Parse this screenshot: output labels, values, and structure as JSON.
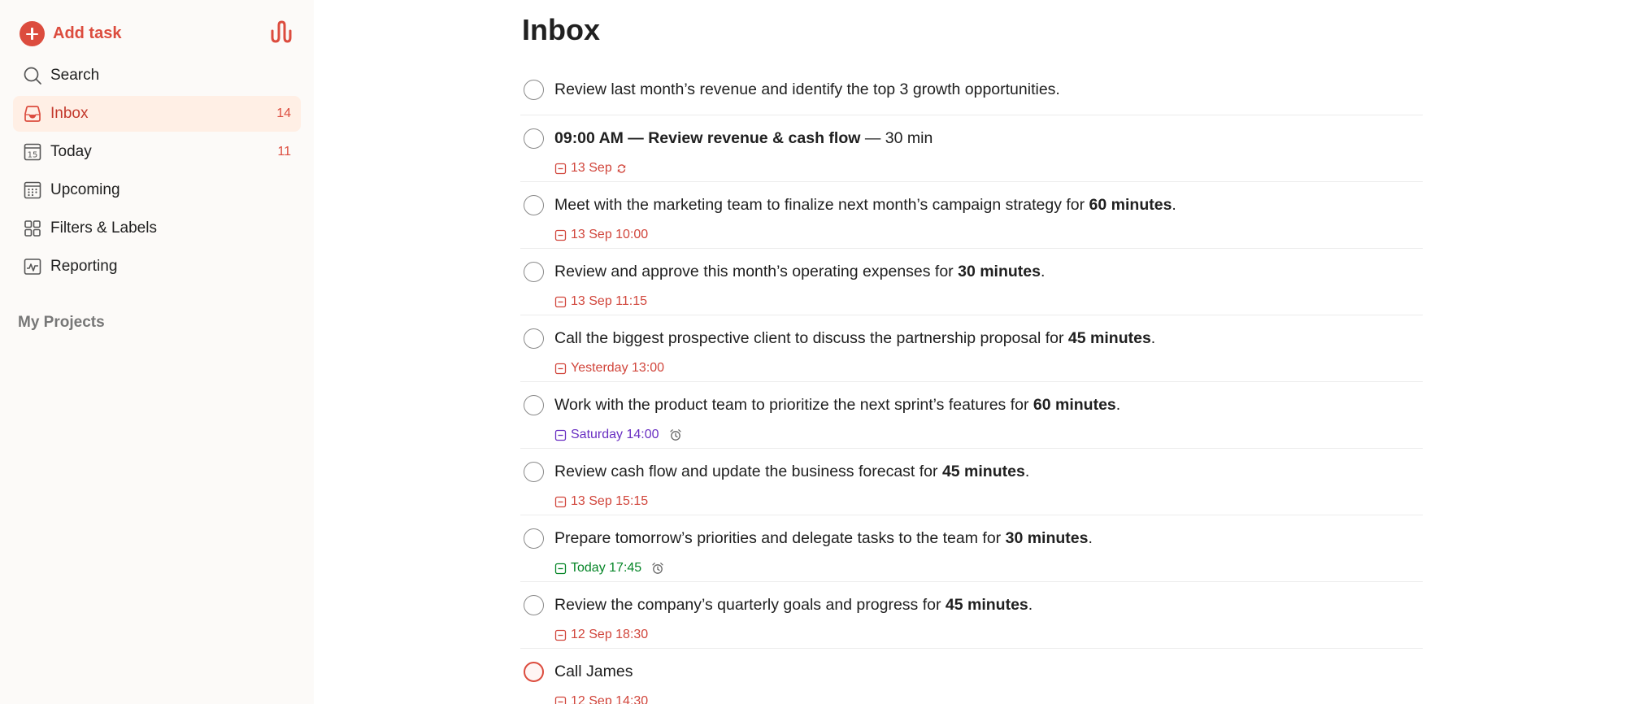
{
  "sidebar": {
    "add_task_label": "Add task",
    "brand_icon": "waveform-logo-icon",
    "nav": [
      {
        "label": "Search",
        "icon": "search-icon",
        "count": ""
      },
      {
        "label": "Inbox",
        "icon": "inbox-icon",
        "count": "14"
      },
      {
        "label": "Today",
        "icon": "calendar-today-icon",
        "count": "11",
        "day": "15"
      },
      {
        "label": "Upcoming",
        "icon": "calendar-grid-icon",
        "count": ""
      },
      {
        "label": "Filters & Labels",
        "icon": "grid-icon",
        "count": ""
      },
      {
        "label": "Reporting",
        "icon": "chart-icon",
        "count": ""
      }
    ],
    "projects_title": "My Projects"
  },
  "main": {
    "title": "Inbox",
    "tasks": [
      {
        "pre": "Review last month’s revenue and identify the top 3 growth opportunities.",
        "bold": "",
        "post": "",
        "date": "",
        "date_color": "",
        "repeat": false,
        "alarm": false
      },
      {
        "pre": "",
        "bold": "09:00 AM — Review revenue & cash flow",
        "post": " — 30 min",
        "date": "13 Sep",
        "date_color": "#d1453b",
        "repeat": true,
        "alarm": false
      },
      {
        "pre": "Meet with the marketing team to finalize next month’s campaign strategy for ",
        "bold": "60 minutes",
        "post": ".",
        "date": "13 Sep 10:00",
        "date_color": "#d1453b",
        "repeat": false,
        "alarm": false
      },
      {
        "pre": "Review and approve this month’s operating expenses for ",
        "bold": "30 minutes",
        "post": ".",
        "date": "13 Sep 11:15",
        "date_color": "#d1453b",
        "repeat": false,
        "alarm": false
      },
      {
        "pre": "Call the biggest prospective client to discuss the partnership proposal for ",
        "bold": "45 minutes",
        "post": ".",
        "date": "Yesterday 13:00",
        "date_color": "#d1453b",
        "repeat": false,
        "alarm": false
      },
      {
        "pre": "Work with the product team to prioritize the next sprint’s features for ",
        "bold": "60 minutes",
        "post": ".",
        "date": "Saturday 14:00",
        "date_color": "#692fc2",
        "repeat": false,
        "alarm": true
      },
      {
        "pre": "Review cash flow and update the business forecast for ",
        "bold": "45 minutes",
        "post": ".",
        "date": "13 Sep 15:15",
        "date_color": "#d1453b",
        "repeat": false,
        "alarm": false
      },
      {
        "pre": "Prepare tomorrow’s priorities and delegate tasks to the team for ",
        "bold": "30 minutes",
        "post": ".",
        "date": "Today 17:45",
        "date_color": "#058527",
        "repeat": false,
        "alarm": true
      },
      {
        "pre": "Review the company’s quarterly goals and progress for ",
        "bold": "45 minutes",
        "post": ".",
        "date": "12 Sep 18:30",
        "date_color": "#d1453b",
        "repeat": false,
        "alarm": false
      },
      {
        "pre": "Call James",
        "bold": "",
        "post": "",
        "date": "12 Sep 14:30",
        "date_color": "#d1453b",
        "repeat": false,
        "alarm": false,
        "priority": "red"
      }
    ]
  }
}
